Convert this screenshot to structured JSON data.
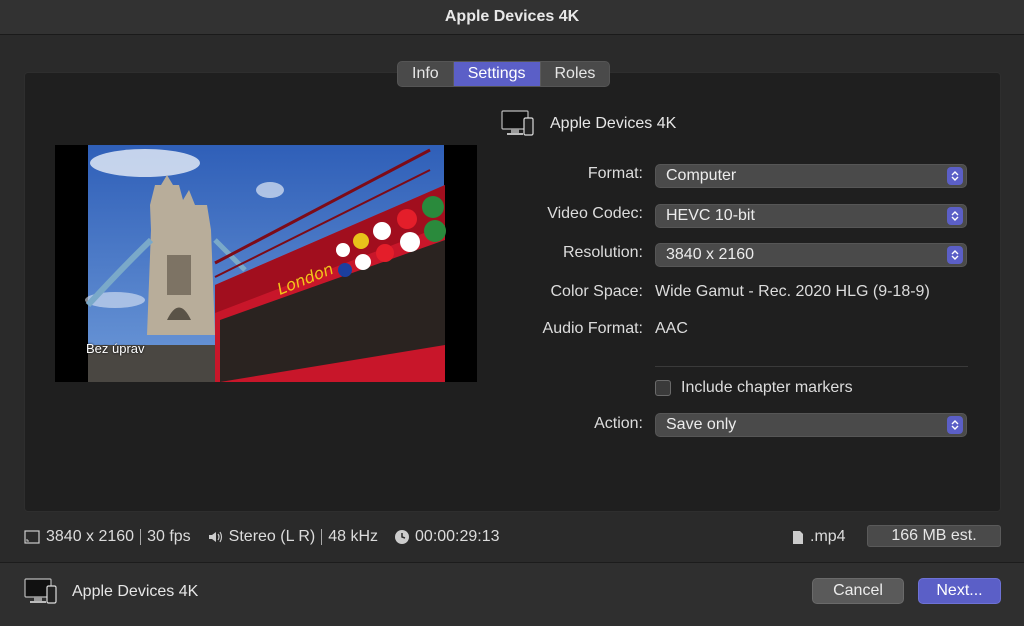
{
  "window": {
    "title": "Apple Devices 4K"
  },
  "tabs": [
    {
      "label": "Info",
      "active": false
    },
    {
      "label": "Settings",
      "active": true
    },
    {
      "label": "Roles",
      "active": false
    }
  ],
  "preview": {
    "overlay_label": "Bez úprav"
  },
  "preset": {
    "icon": "computer-and-phone-icon",
    "name": "Apple Devices 4K"
  },
  "settings": {
    "format": {
      "label": "Format:",
      "value": "Computer"
    },
    "video_codec": {
      "label": "Video Codec:",
      "value": "HEVC 10-bit"
    },
    "resolution": {
      "label": "Resolution:",
      "value": "3840 x 2160"
    },
    "color_space": {
      "label": "Color Space:",
      "value": "Wide Gamut - Rec. 2020 HLG (9-18-9)"
    },
    "audio_format": {
      "label": "Audio Format:",
      "value": "AAC"
    },
    "chapter_markers": {
      "label": "Include chapter markers",
      "checked": false
    },
    "action": {
      "label": "Action:",
      "value": "Save only"
    }
  },
  "info": {
    "resolution": "3840 x 2160",
    "fps": "30 fps",
    "audio_channels": "Stereo (L R)",
    "sample_rate": "48 kHz",
    "duration": "00:00:29:13",
    "file_ext": ".mp4",
    "size_est": "166 MB est."
  },
  "footer": {
    "device_name": "Apple Devices 4K",
    "cancel_label": "Cancel",
    "next_label": "Next..."
  },
  "colors": {
    "accent": "#5b5fc7",
    "background": "#2a2a2a",
    "panel": "#1f1f1f"
  }
}
